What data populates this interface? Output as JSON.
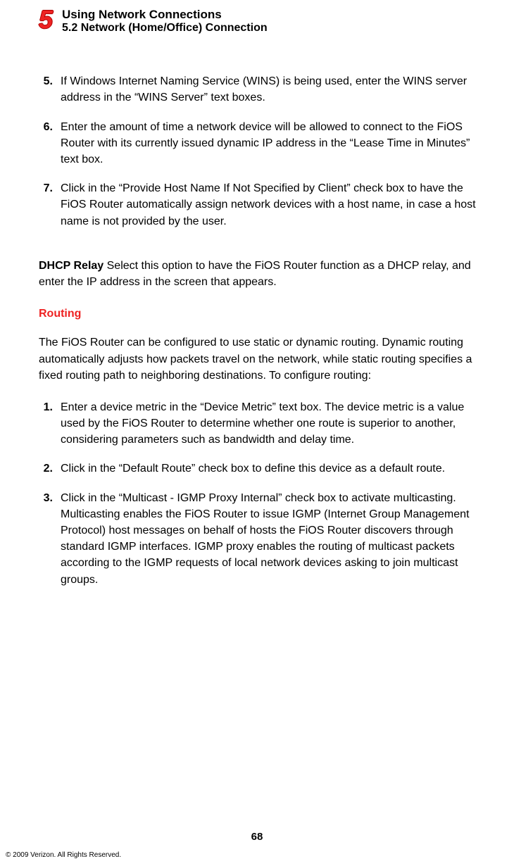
{
  "header": {
    "chapter_number": "5",
    "chapter_title": "Using Network Connections",
    "section_title": "5.2  Network (Home/Office) Connection"
  },
  "list1": {
    "items": [
      {
        "num": "5.",
        "text": "If Windows Internet Naming Service (WINS) is being used, enter the WINS server address in the “WINS Server” text boxes."
      },
      {
        "num": "6.",
        "text": "Enter the amount of time a network device will be allowed to connect to the FiOS Router with its currently issued dynamic IP address in the “Lease Time in Minutes” text box."
      },
      {
        "num": "7.",
        "text": "Click in the “Provide Host Name If Not Specified by Client” check box to have the FiOS Router automatically assign network devices with a host name, in case a host name is not provided by the user."
      }
    ]
  },
  "dhcp_relay": {
    "bold": "DHCP Relay",
    "rest": "   Select this option to have the FiOS Router function as a DHCP relay, and enter the IP address in the screen that appears."
  },
  "routing": {
    "heading": "Routing",
    "intro": "The FiOS Router can be configured to use static or dynamic routing. Dynamic routing automatically adjusts how packets travel on the network, while static routing specifies a fixed routing path to neighboring destinations.  To configure routing:",
    "items": [
      {
        "num": "1.",
        "text": "Enter a device metric in the “Device Metric” text box. The device metric is a value used by the FiOS Router to determine whether one route is superior to another, considering parameters such as bandwidth and delay time."
      },
      {
        "num": "2.",
        "text": "Click in the “Default Route” check box to define this device as a default route."
      },
      {
        "num": "3.",
        "text": "Click in the “Multicast - IGMP Proxy Internal” check box to activate multicasting. Multicasting enables the FiOS Router to issue IGMP (Internet Group Management Protocol) host messages on behalf of hosts the FiOS Router discovers through standard IGMP interfaces. IGMP proxy enables the routing of multicast packets according to the IGMP requests of local network devices asking to join multicast groups."
      }
    ]
  },
  "footer": {
    "page_number": "68",
    "copyright": "© 2009 Verizon. All Rights Reserved."
  }
}
